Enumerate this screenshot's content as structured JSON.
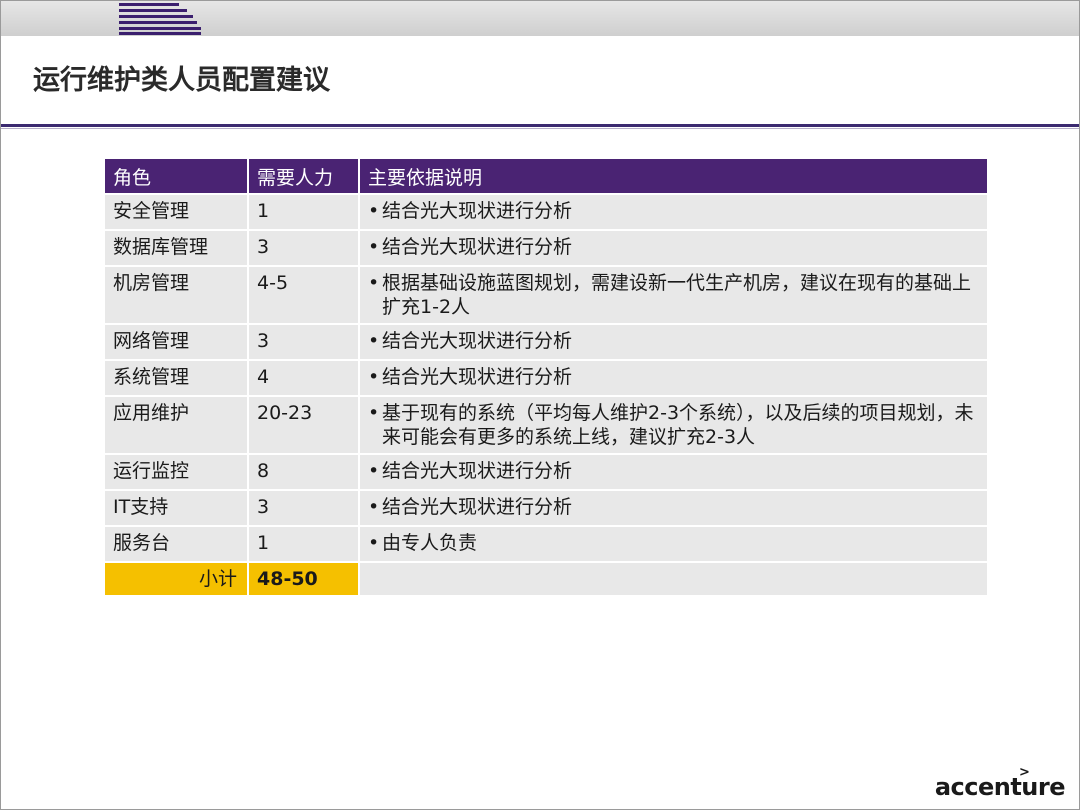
{
  "slide": {
    "title": "运行维护类人员配置建议",
    "colors": {
      "header": "#4a2373",
      "row": "#e8e8e8",
      "total": "#f5c000",
      "rule": "#3b2a70"
    }
  },
  "table": {
    "headers": [
      "角色",
      "需要人力",
      "主要依据说明"
    ],
    "rows": [
      {
        "role": "安全管理",
        "staff": "1",
        "basis": "结合光大现状进行分析"
      },
      {
        "role": "数据库管理",
        "staff": "3",
        "basis": "结合光大现状进行分析"
      },
      {
        "role": "机房管理",
        "staff": "4-5",
        "basis": "根据基础设施蓝图规划，需建设新一代生产机房，建议在现有的基础上扩充1-2人"
      },
      {
        "role": "网络管理",
        "staff": "3",
        "basis": "结合光大现状进行分析"
      },
      {
        "role": "系统管理",
        "staff": "4",
        "basis": "结合光大现状进行分析"
      },
      {
        "role": "应用维护",
        "staff": "20-23",
        "basis": "基于现有的系统（平均每人维护2-3个系统），以及后续的项目规划，未来可能会有更多的系统上线，建议扩充2-3人"
      },
      {
        "role": "运行监控",
        "staff": "8",
        "basis": "结合光大现状进行分析"
      },
      {
        "role": "IT支持",
        "staff": "3",
        "basis": "结合光大现状进行分析"
      },
      {
        "role": "服务台",
        "staff": "1",
        "basis": "由专人负责"
      }
    ],
    "bullet": "•",
    "total": {
      "label": "小计",
      "value": "48-50"
    }
  },
  "footer": {
    "brand": "accenture",
    "brand_mark": ">"
  }
}
